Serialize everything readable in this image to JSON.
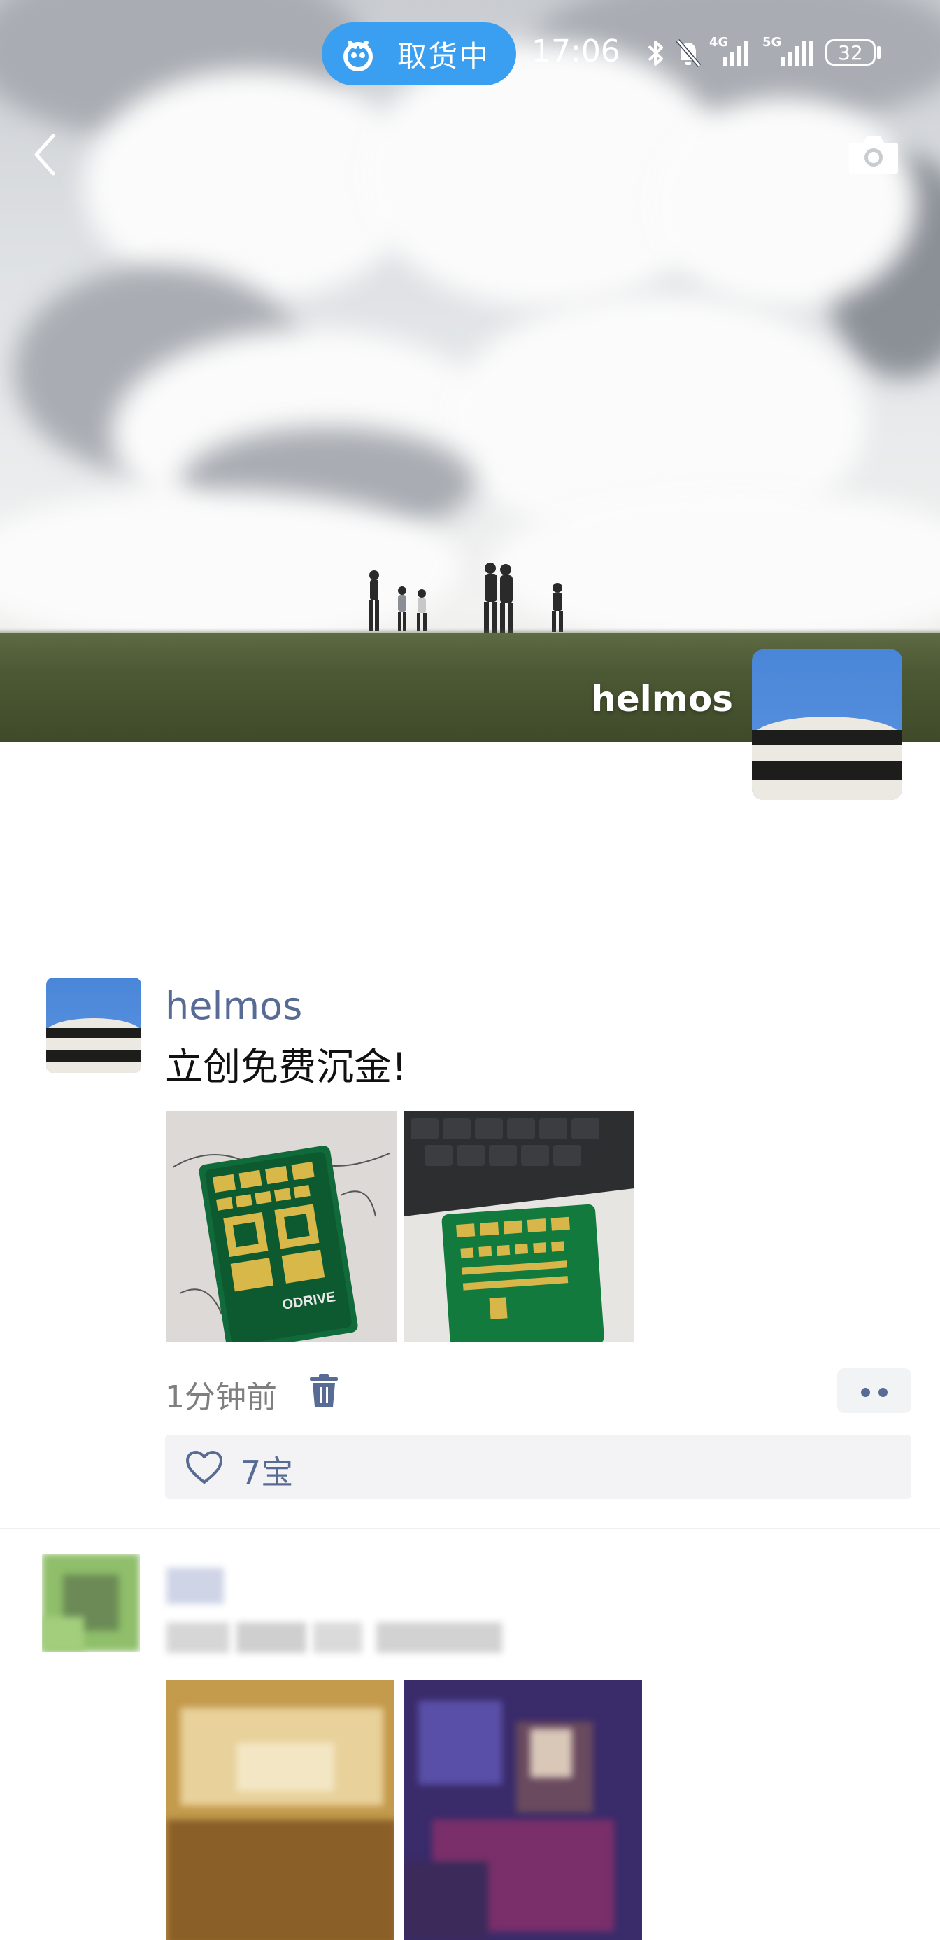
{
  "status_bar": {
    "pickup_label": "取货中",
    "time": "17:06",
    "network_4g": "4G",
    "network_5g": "5G",
    "battery": "32"
  },
  "profile": {
    "name": "helmos"
  },
  "post": {
    "author": "helmos",
    "text": "立创免费沉金!",
    "time": "1分钟前",
    "likes": "7宝",
    "photos": [
      "pcb-photo-1",
      "pcb-photo-2"
    ]
  },
  "icons": {
    "back": "chevron-left-icon",
    "camera": "camera-icon",
    "delete": "trash-icon",
    "like": "heart-icon",
    "more": "more-dots-icon"
  },
  "colors": {
    "link_blue": "#576b95",
    "pill_blue": "#3a9ff0"
  }
}
